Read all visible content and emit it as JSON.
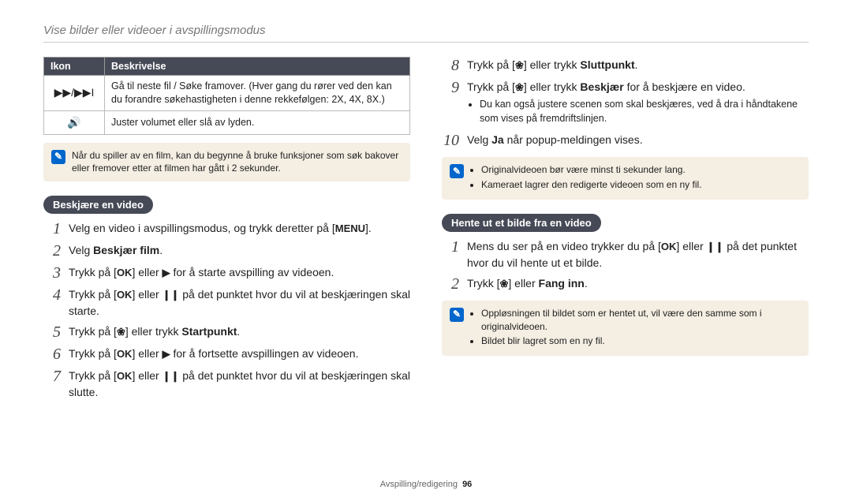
{
  "header": {
    "title": "Vise bilder eller videoer i avspillingsmodus"
  },
  "table": {
    "headers": {
      "icon": "Ikon",
      "desc": "Beskrivelse"
    },
    "rows": [
      {
        "icon_name": "ff-next-icon",
        "icon_glyph": "▶▶/▶▶I",
        "desc": "Gå til neste fil / Søke framover. (Hver gang du rører ved den kan du forandre søkehastigheten i denne rekkefølgen: 2X, 4X, 8X.)"
      },
      {
        "icon_name": "volume-icon",
        "icon_glyph": "🔊",
        "desc": "Juster volumet eller slå av lyden."
      }
    ]
  },
  "note_top": {
    "icon_label": "✎",
    "text": "Når du spiller av en film, kan du begynne å bruke funksjoner som søk bakover eller fremover etter at filmen har gått i 2 sekunder."
  },
  "section_trim": {
    "label": "Beskjære en video",
    "steps": [
      {
        "n": "1",
        "html": "Velg en video i avspillingsmodus, og trykk deretter på [<span class='inline-icon' data-name='menu-button-icon'>MENU</span>]."
      },
      {
        "n": "2",
        "html": "Velg <strong>Beskjær film</strong>."
      },
      {
        "n": "3",
        "html": "Trykk på [<span class='inline-icon' data-name='ok-button-icon'>OK</span>] eller <span class='inline-icon' data-name='play-icon'>▶</span> for å starte avspilling av videoen."
      },
      {
        "n": "4",
        "html": "Trykk på [<span class='inline-icon' data-name='ok-button-icon'>OK</span>] eller <span class='inline-icon' data-name='pause-icon'>❙❙</span> på det punktet hvor du vil at beskjæringen skal starte."
      },
      {
        "n": "5",
        "html": "Trykk på [<span class='inline-icon' data-name='macro-button-icon'>❀</span>] eller trykk <strong>Startpunkt</strong>."
      },
      {
        "n": "6",
        "html": "Trykk på [<span class='inline-icon' data-name='ok-button-icon'>OK</span>] eller <span class='inline-icon' data-name='play-icon'>▶</span> for å fortsette avspillingen av videoen."
      },
      {
        "n": "7",
        "html": "Trykk på [<span class='inline-icon' data-name='ok-button-icon'>OK</span>] eller <span class='inline-icon' data-name='pause-icon'>❙❙</span> på det punktet hvor du vil at beskjæringen skal slutte."
      }
    ]
  },
  "right_steps_cont": [
    {
      "n": "8",
      "html": "Trykk på [<span class='inline-icon' data-name='macro-button-icon'>❀</span>] eller trykk <strong>Sluttpunkt</strong>."
    },
    {
      "n": "9",
      "html": "Trykk på [<span class='inline-icon' data-name='macro-button-icon'>❀</span>] eller trykk <strong>Beskjær</strong> for å beskjære en video.",
      "sub": [
        "Du kan også justere scenen som skal beskjæres, ved å dra i håndtakene som vises på fremdriftslinjen."
      ]
    },
    {
      "n": "10",
      "html": "Velg <strong>Ja</strong> når popup-meldingen vises."
    }
  ],
  "note_right1": {
    "icon_label": "✎",
    "items": [
      "Originalvideoen bør være minst ti sekunder lang.",
      "Kameraet lagrer den redigerte videoen som en ny fil."
    ]
  },
  "section_capture": {
    "label": "Hente ut et bilde fra en video",
    "steps": [
      {
        "n": "1",
        "html": "Mens du ser på en video trykker du på [<span class='inline-icon' data-name='ok-button-icon'>OK</span>] eller <span class='inline-icon' data-name='pause-icon'>❙❙</span> på det punktet hvor du vil hente ut et bilde."
      },
      {
        "n": "2",
        "html": "Trykk [<span class='inline-icon' data-name='macro-button-icon'>❀</span>] eller <strong>Fang inn</strong>."
      }
    ]
  },
  "note_right2": {
    "icon_label": "✎",
    "items": [
      "Oppløsningen til bildet som er hentet ut, vil være den samme som i originalvideoen.",
      "Bildet blir lagret som en ny fil."
    ]
  },
  "footer": {
    "section": "Avspilling/redigering",
    "page": "96"
  }
}
